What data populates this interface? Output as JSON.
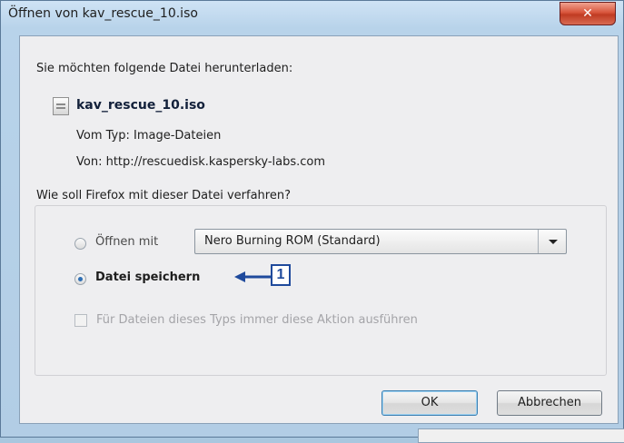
{
  "window": {
    "title": "Öffnen von kav_rescue_10.iso",
    "close_label": "✕"
  },
  "dialog": {
    "intro": "Sie möchten folgende Datei herunterladen:",
    "file_name": "kav_rescue_10.iso",
    "type_line": "Vom Typ:  Image-Dateien",
    "from_line": "Von:  http://rescuedisk.kaspersky-labs.com",
    "question": "Wie soll Firefox mit dieser Datei verfahren?",
    "open_with_label": "Öffnen mit",
    "open_with_value": "Nero Burning ROM (Standard)",
    "save_label": "Datei speichern",
    "always_label": "Für Dateien dieses Typs immer diese Aktion ausführen",
    "ok_label": "OK",
    "cancel_label": "Abbrechen"
  },
  "annotation": {
    "marker": "1",
    "color": "#1f4a9c"
  }
}
